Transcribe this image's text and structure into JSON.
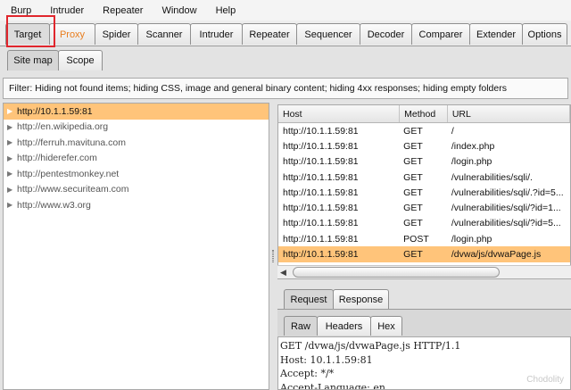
{
  "menubar": [
    "Burp",
    "Intruder",
    "Repeater",
    "Window",
    "Help"
  ],
  "main_tabs": [
    "Target",
    "Proxy",
    "Spider",
    "Scanner",
    "Intruder",
    "Repeater",
    "Sequencer",
    "Decoder",
    "Comparer",
    "Extender",
    "Options"
  ],
  "active_main_tab": "Target",
  "target_subtabs": [
    "Site map",
    "Scope"
  ],
  "filter_text": "Filter:  Hiding not found items;  hiding CSS, image and general binary content;  hiding 4xx responses;  hiding empty folders",
  "tree_items": [
    "http://10.1.1.59:81",
    "http://en.wikipedia.org",
    "http://ferruh.mavituna.com",
    "http://hiderefer.com",
    "http://pentestmonkey.net",
    "http://www.securiteam.com",
    "http://www.w3.org"
  ],
  "table": {
    "headers": [
      "Host",
      "Method",
      "URL"
    ],
    "rows": [
      [
        "http://10.1.1.59:81",
        "GET",
        "/"
      ],
      [
        "http://10.1.1.59:81",
        "GET",
        "/index.php"
      ],
      [
        "http://10.1.1.59:81",
        "GET",
        "/login.php"
      ],
      [
        "http://10.1.1.59:81",
        "GET",
        "/vulnerabilities/sqli/."
      ],
      [
        "http://10.1.1.59:81",
        "GET",
        "/vulnerabilities/sqli/.?id=5..."
      ],
      [
        "http://10.1.1.59:81",
        "GET",
        "/vulnerabilities/sqli/?id=1..."
      ],
      [
        "http://10.1.1.59:81",
        "GET",
        "/vulnerabilities/sqli/?id=5..."
      ],
      [
        "http://10.1.1.59:81",
        "POST",
        "/login.php"
      ],
      [
        "http://10.1.1.59:81",
        "GET",
        "/dvwa/js/dvwaPage.js"
      ]
    ],
    "selected_row": 8
  },
  "message_tabs": [
    "Request",
    "Response"
  ],
  "view_tabs": [
    "Raw",
    "Headers",
    "Hex"
  ],
  "raw_lines": [
    "GET /dvwa/js/dvwaPage.js HTTP/1.1",
    "Host: 10.1.1.59:81",
    "Accept: */*",
    "Accept-Language: en"
  ],
  "watermark": "Chodolity",
  "colors": {
    "selection": "#ffc47a",
    "proxy_text": "#e87d1e",
    "highlight_box": "#e0262d"
  }
}
